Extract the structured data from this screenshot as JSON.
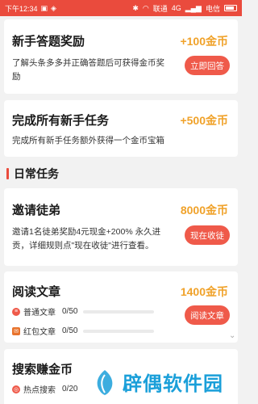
{
  "status_bar": {
    "time": "下午12:34",
    "network": "4G",
    "carrier_1": "联通",
    "carrier_2": "电信"
  },
  "tasks_new": [
    {
      "title": "新手答题奖励",
      "reward": "+100金币",
      "desc_line1": "了解头条多多并正确答题后可获得金币奖",
      "desc_line2": "励",
      "button": "立即回答"
    },
    {
      "title": "完成所有新手任务",
      "reward": "+500金币",
      "desc_line1": "完成所有新手任务额外获得一个金币宝箱"
    }
  ],
  "daily_section": {
    "label": "日常任务"
  },
  "invite": {
    "title": "邀请徒弟",
    "reward": "8000金币",
    "desc_line1": "邀请1名徒弟奖励4元现金+200% 永久进",
    "desc_line2": "贡，详细规则点\"现在收徒\"进行查看。",
    "button": "现在收徒"
  },
  "read": {
    "title": "阅读文章",
    "reward": "1400金币",
    "button": "阅读文章",
    "rows": [
      {
        "label": "普通文章",
        "count": "0/50",
        "progress": 0
      },
      {
        "label": "红包文章",
        "count": "0/50",
        "progress": 0
      }
    ]
  },
  "search": {
    "title": "搜索赚金币",
    "rows": [
      {
        "label": "热点搜索",
        "count": "0/20"
      }
    ]
  },
  "watermark": {
    "text": "辟偶软件园"
  },
  "colors": {
    "accent": "#ea4b3d",
    "reward": "#f0a22a",
    "button": "#ef5a4a",
    "watermark": "#1a9fd9"
  }
}
